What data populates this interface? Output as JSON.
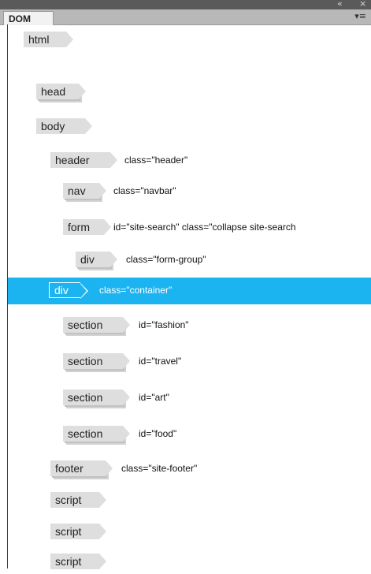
{
  "window": {
    "collapse_glyph": "«",
    "close_glyph": "×"
  },
  "tab": {
    "label": "DOM"
  },
  "menu_icon": "▾≡",
  "tree": [
    {
      "tag": "html",
      "attrs": ""
    },
    {
      "tag": "head",
      "attrs": ""
    },
    {
      "tag": "body",
      "attrs": ""
    },
    {
      "tag": "header",
      "attrs": "class=\"header\""
    },
    {
      "tag": "nav",
      "attrs": "class=\"navbar\""
    },
    {
      "tag": "form",
      "attrs": "id=\"site-search\" class=\"collapse site-search"
    },
    {
      "tag": "div",
      "attrs": "class=\"form-group\""
    },
    {
      "tag": "div",
      "attrs": "class=\"container\"",
      "selected": true
    },
    {
      "tag": "section",
      "attrs": "id=\"fashion\""
    },
    {
      "tag": "section",
      "attrs": "id=\"travel\""
    },
    {
      "tag": "section",
      "attrs": "id=\"art\""
    },
    {
      "tag": "section",
      "attrs": "id=\"food\""
    },
    {
      "tag": "footer",
      "attrs": "class=\"site-footer\""
    },
    {
      "tag": "script",
      "attrs": ""
    },
    {
      "tag": "script",
      "attrs": ""
    },
    {
      "tag": "script",
      "attrs": ""
    }
  ],
  "colors": {
    "selection": "#1cb4f0",
    "tag_bg": "#dedede"
  }
}
